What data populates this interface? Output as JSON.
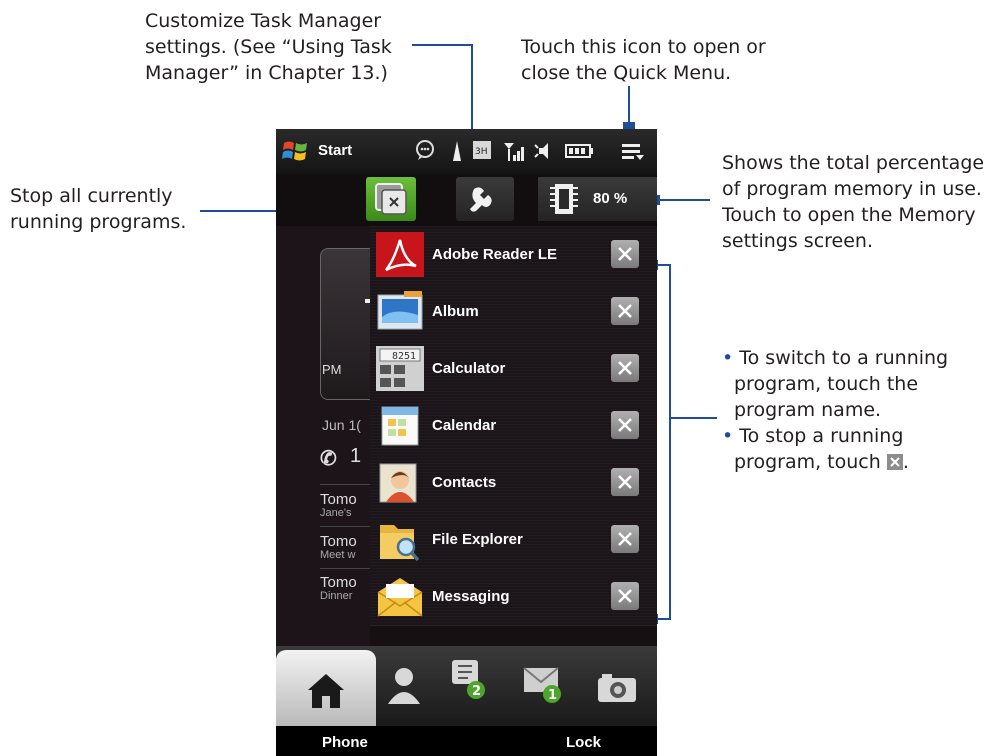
{
  "callouts": {
    "customize": [
      "Customize Task Manager",
      "settings. (See “Using Task",
      "Manager” in Chapter 13.)"
    ],
    "quick_menu": [
      "Touch this icon to open or",
      "close the Quick Menu."
    ],
    "stop_all": [
      "Stop all currently",
      "running programs."
    ],
    "memory": [
      "Shows the total percentage",
      "of program memory in use.",
      "Touch to open the Memory",
      "settings screen."
    ],
    "bullet1": [
      "To switch to a running",
      "program, touch the",
      "program name."
    ],
    "bullet2_line1": "To stop a running",
    "bullet2_line2": "program, touch",
    "bullet2_end": "."
  },
  "status_bar": {
    "start_label": "Start",
    "icons": [
      "windows-flag-icon",
      "notification-bubble-icon",
      "signal-antenna-icon",
      "hsdpa-icon",
      "signal-bars-icon",
      "speaker-icon",
      "battery-icon",
      "quick-menu-icon"
    ]
  },
  "task_manager": {
    "memory_percent": "80 %",
    "tasks": [
      {
        "name": "Adobe Reader LE",
        "icon": "adobe-reader-icon"
      },
      {
        "name": "Album",
        "icon": "album-icon"
      },
      {
        "name": "Calculator",
        "icon": "calculator-icon"
      },
      {
        "name": "Calendar",
        "icon": "calendar-icon"
      },
      {
        "name": "Contacts",
        "icon": "contacts-icon"
      },
      {
        "name": "File Explorer",
        "icon": "file-explorer-icon"
      },
      {
        "name": "Messaging",
        "icon": "messaging-icon"
      }
    ]
  },
  "home_fragments": {
    "pm": "PM",
    "date": "Jun 1(",
    "missed": "1",
    "items": [
      {
        "title": "Tomo",
        "sub": "Jane's"
      },
      {
        "title": "Tomo",
        "sub": "Meet w"
      },
      {
        "title": "Tomo",
        "sub": "Dinner"
      }
    ]
  },
  "calculator_display": "8251",
  "softkeys": {
    "left": "Phone",
    "right": "Lock"
  },
  "badges": {
    "messages": "2",
    "email": "1"
  },
  "colors": {
    "leader": "#1f4e96",
    "stop_all_green": "#4d9e26",
    "adobe_red": "#c8151b"
  }
}
